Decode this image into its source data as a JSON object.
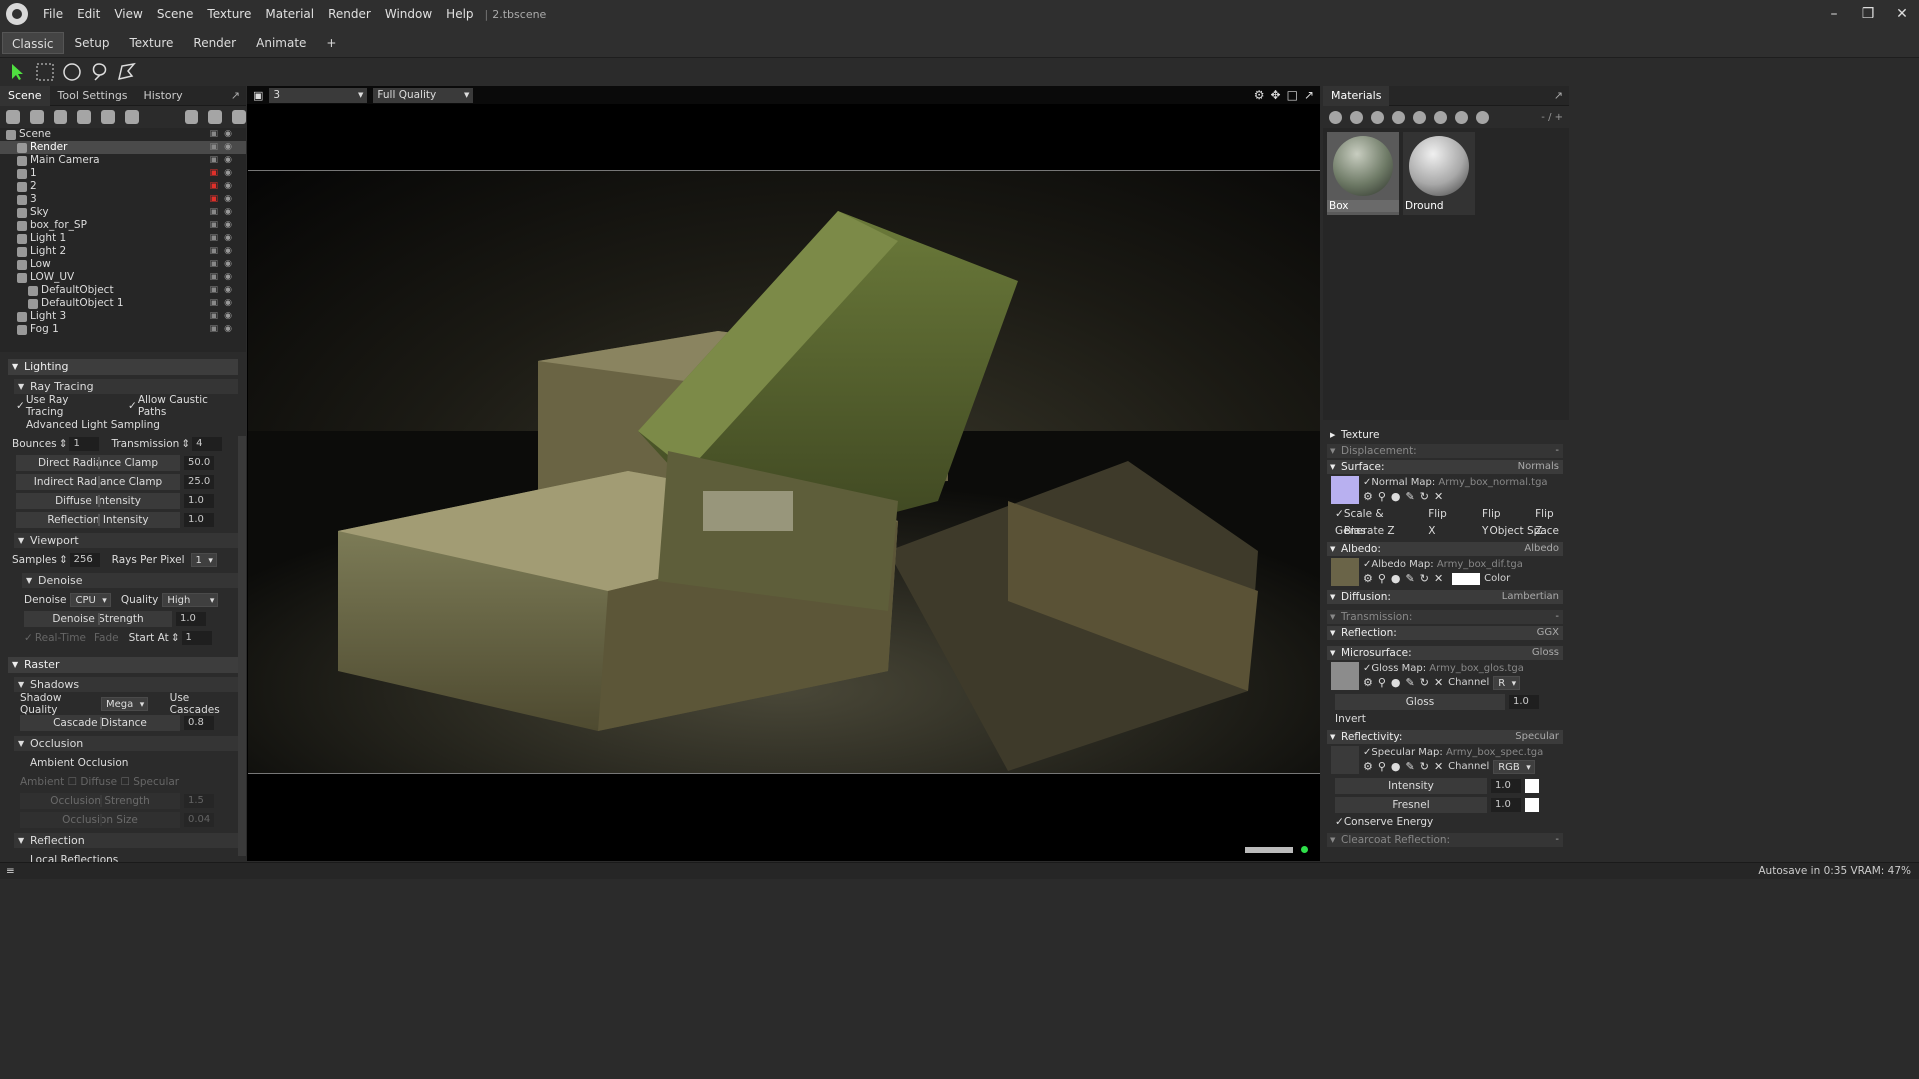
{
  "menubar": {
    "items": [
      "File",
      "Edit",
      "View",
      "Scene",
      "Texture",
      "Material",
      "Render",
      "Window",
      "Help"
    ],
    "separator": "|",
    "file_title": "2.tbscene",
    "window_controls": [
      "–",
      "❒",
      "✕"
    ]
  },
  "tabs": [
    "Classic",
    "Setup",
    "Texture",
    "Render",
    "Animate",
    "+"
  ],
  "toolbar": {
    "tools": [
      "select-arrow-icon",
      "rect-select-icon",
      "circle-select-icon",
      "lasso-icon",
      "poly-lasso-icon"
    ],
    "active_color": "#4fe040"
  },
  "left_panel": {
    "tabs": [
      "Scene",
      "Tool Settings",
      "History"
    ],
    "tree": [
      {
        "label": "Scene",
        "indent": 0,
        "locked": false
      },
      {
        "label": "Render",
        "indent": 1,
        "locked": false,
        "selected": true
      },
      {
        "label": "Main Camera",
        "indent": 1,
        "locked": false
      },
      {
        "label": "1",
        "indent": 1,
        "locked": true
      },
      {
        "label": "2",
        "indent": 1,
        "locked": true
      },
      {
        "label": "3",
        "indent": 1,
        "locked": true
      },
      {
        "label": "Sky",
        "indent": 1,
        "locked": false
      },
      {
        "label": "box_for_SP",
        "indent": 1,
        "locked": false
      },
      {
        "label": "Light 1",
        "indent": 1,
        "locked": false
      },
      {
        "label": "Light 2",
        "indent": 1,
        "locked": false
      },
      {
        "label": "Low",
        "indent": 1,
        "locked": false
      },
      {
        "label": "LOW_UV",
        "indent": 1,
        "locked": false
      },
      {
        "label": "DefaultObject",
        "indent": 2,
        "locked": false
      },
      {
        "label": "DefaultObject 1",
        "indent": 2,
        "locked": false
      },
      {
        "label": "Light 3",
        "indent": 1,
        "locked": false
      },
      {
        "label": "Fog 1",
        "indent": 1,
        "locked": false
      }
    ],
    "lighting": {
      "title": "Lighting",
      "ray_tracing": "Ray Tracing",
      "use_ray_tracing": "Use Ray Tracing",
      "allow_caustic": "Allow Caustic Paths",
      "advanced_light_sampling": "Advanced Light Sampling",
      "bounces_label": "Bounces",
      "bounces": "1",
      "transmission_label": "Transmission",
      "transmission": "4",
      "direct_clamp_label": "Direct Radiance Clamp",
      "direct_clamp": "50.0",
      "indirect_clamp_label": "Indirect Radiance Clamp",
      "indirect_clamp": "25.0",
      "diffuse_label": "Diffuse Intensity",
      "diffuse": "1.0",
      "reflection_int_label": "Reflection Intensity",
      "reflection_int": "1.0"
    },
    "viewport": {
      "title": "Viewport",
      "samples_label": "Samples",
      "samples": "256",
      "rays_label": "Rays Per Pixel",
      "rays": "1",
      "denoise_title": "Denoise",
      "denoise_label": "Denoise",
      "denoise": "CPU",
      "quality_label": "Quality",
      "quality": "High",
      "strength_label": "Denoise Strength",
      "strength": "1.0",
      "realtime_label": "Real-Time",
      "fade_label": "Fade",
      "start_at_label": "Start At",
      "start_at": "1"
    },
    "raster": {
      "title": "Raster",
      "shadows_title": "Shadows",
      "shadow_quality_label": "Shadow Quality",
      "shadow_quality": "Mega",
      "use_cascades": "Use Cascades",
      "cascade_label": "Cascade Distance",
      "cascade": "0.8",
      "occlusion_title": "Occlusion",
      "ambient_occlusion": "Ambient Occlusion",
      "ao_opts": "Ambient ☐ Diffuse ☐ Specular",
      "occ_strength_label": "Occlusion Strength",
      "occ_strength": "1.5",
      "occ_size_label": "Occlusion Size",
      "occ_size": "0.04",
      "reflection_title": "Reflection",
      "local_reflections": "Local Reflections"
    }
  },
  "viewport_header": {
    "camera": "3",
    "quality": "Full Quality"
  },
  "right_panel": {
    "title": "Materials",
    "page": "- / +",
    "materials": [
      {
        "name": "Box",
        "selected": true,
        "color": "#7a8a7a"
      },
      {
        "name": "Dround",
        "selected": false,
        "color": "#b8b8b8"
      }
    ],
    "texture": "Texture",
    "displacement": "Displacement:",
    "displacement_val": "-",
    "surface": "Surface:",
    "surface_val": "Normals",
    "normal_map_label": "Normal Map:",
    "normal_map_file": "Army_box_normal.tga",
    "scale_bias": "Scale & Bias",
    "flip_x": "Flip X",
    "flip_y": "Flip Y",
    "flip_z": "Flip Z",
    "generate_z": "Generate Z",
    "object_space": "Object Space",
    "albedo": "Albedo:",
    "albedo_val": "Albedo",
    "albedo_map_label": "Albedo Map:",
    "albedo_map_file": "Army_box_dif.tga",
    "color_label": "Color",
    "diffusion": "Diffusion:",
    "diffusion_val": "Lambertian",
    "transmission": "Transmission:",
    "transmission_val": "-",
    "reflection": "Reflection:",
    "reflection_val": "GGX",
    "microsurface": "Microsurface:",
    "microsurface_val": "Gloss",
    "gloss_map_label": "Gloss Map:",
    "gloss_map_file": "Army_box_glos.tga",
    "channel_label": "Channel",
    "gloss_channel": "R",
    "gloss_label": "Gloss",
    "gloss": "1.0",
    "invert": "Invert",
    "reflectivity": "Reflectivity:",
    "reflectivity_val": "Specular",
    "spec_map_label": "Specular Map:",
    "spec_map_file": "Army_box_spec.tga",
    "spec_channel": "RGB",
    "intensity_label": "Intensity",
    "intensity": "1.0",
    "fresnel_label": "Fresnel",
    "fresnel": "1.0",
    "conserve_energy": "Conserve Energy",
    "clearcoat": "Clearcoat Reflection:",
    "clearcoat_val": "-"
  },
  "status": {
    "autosave": "Autosave in 0:35  VRAM: 47%"
  }
}
